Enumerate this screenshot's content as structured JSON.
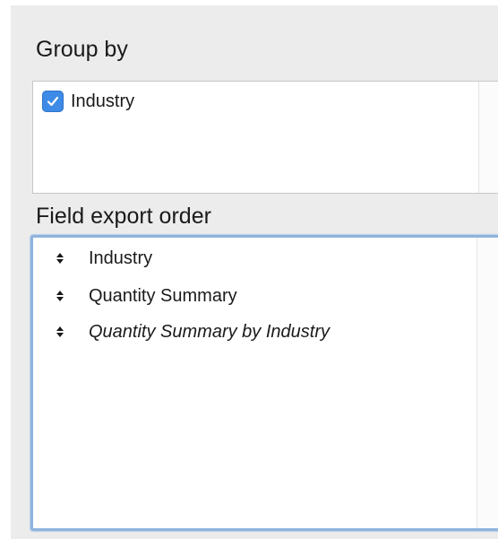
{
  "group_by": {
    "title": "Group by",
    "items": [
      {
        "label": "Industry",
        "checked": true
      }
    ]
  },
  "field_export_order": {
    "title": "Field export order",
    "items": [
      {
        "label": "Industry",
        "italic": false,
        "icon": "reorder-handle-icon"
      },
      {
        "label": "Quantity Summary",
        "italic": false,
        "icon": "reorder-handle-icon"
      },
      {
        "label": "Quantity Summary by Industry",
        "italic": true,
        "icon": "reorder-handle-icon"
      }
    ]
  },
  "colors": {
    "panel_background": "#ececec",
    "checkbox_accent": "#3d8be6",
    "focus_ring": "#8fb3dd"
  }
}
